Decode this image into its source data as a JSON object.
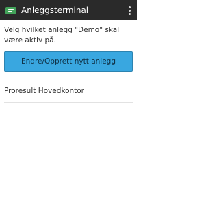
{
  "app_bar": {
    "title": "Anleggsterminal",
    "app_icon": "terminal-card-icon",
    "menu_icon": "overflow-menu-icon",
    "background_color": "#2a2a2a",
    "icon_color": "#43a35a"
  },
  "main": {
    "instruction": "Velg hvilket anlegg \"Demo\" skal være aktiv på.",
    "primary_button_label": "Endre/Opprett nytt anlegg",
    "button_color": "#39a7e0",
    "accent_line_color": "#6a9f6a",
    "facilities": [
      {
        "name": "Proresult Hovedkontor"
      }
    ]
  }
}
